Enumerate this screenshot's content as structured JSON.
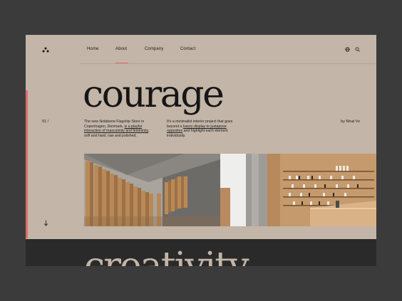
{
  "nav": {
    "items": [
      {
        "label": "Home"
      },
      {
        "label": "About",
        "active": true
      },
      {
        "label": "Company"
      },
      {
        "label": "Contact"
      }
    ]
  },
  "header": {
    "icons": [
      "globe-icon",
      "search-icon"
    ]
  },
  "hero": {
    "headline": "courage",
    "index": "01 /",
    "para1": {
      "t1": "The new Notabene Flagship Store in Copenhagen, Denmark, ",
      "link": "is a playful interaction of masculinity and femininity",
      "t2": ", soft and hard, raw and polished."
    },
    "para2": {
      "t1": "It's a minimalist interior project that goes beyond a ",
      "link": "luxury display to juxtapose opposites",
      "t2": " and highlight each element individually."
    },
    "author": "by Nhat Vo",
    "next_headline": "creativity"
  },
  "colors": {
    "frame_bg": "#c3b5a7",
    "outer_bg": "#3b3b3b",
    "accent": "#e36b6e",
    "dark_band": "#2a2a2a",
    "text": "#1c1c1c"
  }
}
